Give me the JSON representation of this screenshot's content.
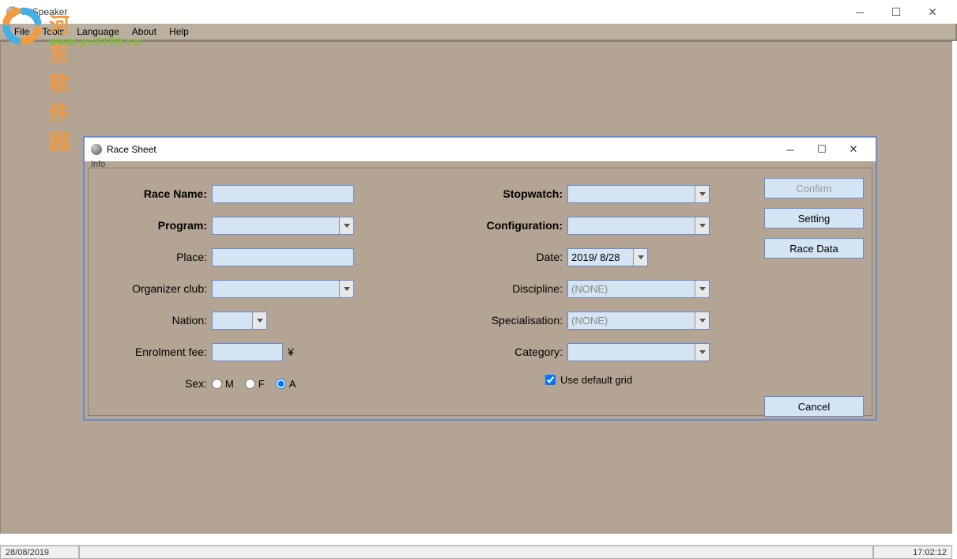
{
  "main": {
    "title": "MiSpeaker",
    "menubar": [
      "File",
      "Tools",
      "Language",
      "About",
      "Help"
    ]
  },
  "watermark": {
    "line1": "河东软件园",
    "line2": "www.pc0359.cn"
  },
  "statusbar": {
    "date": "28/08/2019",
    "time": "17:02:12"
  },
  "dialog": {
    "title": "Race Sheet",
    "group_label": "Info",
    "left": {
      "race_name": {
        "label": "Race Name:",
        "value": ""
      },
      "program": {
        "label": "Program:",
        "value": ""
      },
      "place": {
        "label": "Place:",
        "value": ""
      },
      "organizer": {
        "label": "Organizer club:",
        "value": ""
      },
      "nation": {
        "label": "Nation:",
        "value": ""
      },
      "enrolment": {
        "label": "Enrolment fee:",
        "value": "",
        "currency": "¥"
      },
      "sex": {
        "label": "Sex:",
        "options": [
          "M",
          "F",
          "A"
        ],
        "selected": "A"
      }
    },
    "right": {
      "stopwatch": {
        "label": "Stopwatch:",
        "value": ""
      },
      "configuration": {
        "label": "Configuration:",
        "value": ""
      },
      "date": {
        "label": "Date:",
        "value": "2019/  8/28"
      },
      "discipline": {
        "label": "Discipline:",
        "value": "(NONE)"
      },
      "specialisation": {
        "label": "Specialisation:",
        "value": "(NONE)"
      },
      "category": {
        "label": "Category:",
        "value": ""
      },
      "default_grid": {
        "label": "Use default grid",
        "checked": true
      }
    },
    "buttons": {
      "confirm": "Confirm",
      "setting": "Setting",
      "race_data": "Race Data",
      "cancel": "Cancel"
    }
  }
}
